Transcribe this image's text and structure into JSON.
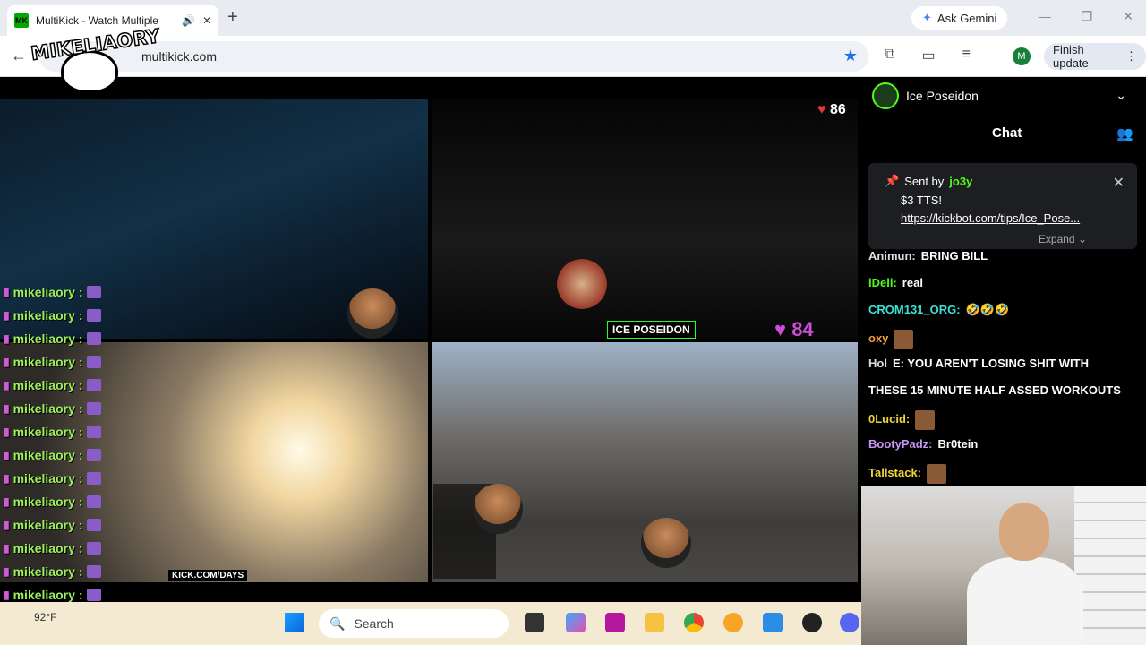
{
  "browser": {
    "tab_title": "MultiKick - Watch Multiple",
    "favicon_text": "MK",
    "ask_gemini": "Ask Gemini",
    "url": "multikick.com",
    "profile_initial": "M",
    "finish_update": "Finish update"
  },
  "logo": {
    "text": "MIKELIAORY"
  },
  "streams": {
    "heart_count": "86",
    "viewer_count": "84",
    "ice_tag": "ICE POSEIDON",
    "kick_days": "KICK.COM/DAYS"
  },
  "left_chat": {
    "username": "mikeliaory",
    "separator": ":",
    "rows": 14
  },
  "right_panel": {
    "streamer": "Ice Poseidon",
    "chat_title": "Chat",
    "pinned": {
      "sent_by": "Sent by",
      "user": "jo3y",
      "amount": "$3 TTS!",
      "link": "https://kickbot.com/tips/Ice_Pose...",
      "expand": "Expand"
    },
    "messages": [
      {
        "user": "Animun:",
        "text": "BRING BILL",
        "color": "white"
      },
      {
        "user": "iDeli:",
        "text": "real",
        "color": "green"
      },
      {
        "user": "CROM131_ORG:",
        "text": "🤣🤣🤣",
        "color": "cyan"
      },
      {
        "user": "oxy",
        "text": "",
        "color": "orange"
      },
      {
        "user": "Hol",
        "text": "E: YOU AREN'T LOSING SHIT WITH",
        "color": "white"
      },
      {
        "user": "",
        "text": "THESE 15 MINUTE HALF ASSED WORKOUTS",
        "color": "white"
      },
      {
        "user": "0Lucid:",
        "text": "",
        "color": "gold"
      },
      {
        "user": "BootyPadz:",
        "text": "Br0tein",
        "color": "purple"
      },
      {
        "user": "Tallstack:",
        "text": "",
        "color": "gold"
      }
    ]
  },
  "taskbar": {
    "temp": "92°F",
    "search": "Search"
  }
}
